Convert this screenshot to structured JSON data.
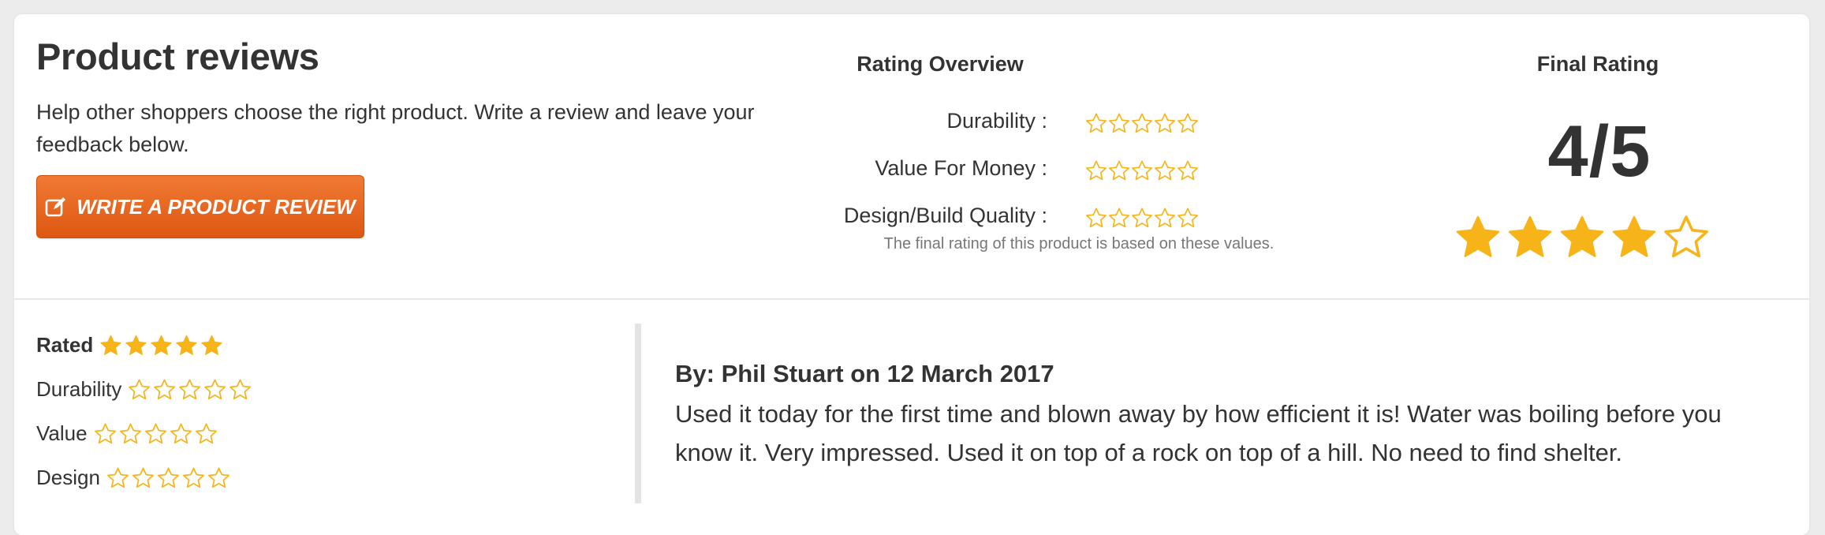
{
  "header": {
    "title": "Product reviews",
    "intro": "Help other shoppers choose the right product. Write a review and leave your feedback below.",
    "write_button_label": "WRITE A PRODUCT REVIEW"
  },
  "overview": {
    "title": "Rating Overview",
    "items": [
      {
        "label": "Durability :",
        "stars_filled": 0,
        "stars_total": 5
      },
      {
        "label": "Value For Money :",
        "stars_filled": 0,
        "stars_total": 5
      },
      {
        "label": "Design/Build Quality :",
        "stars_filled": 0,
        "stars_total": 5
      }
    ],
    "footnote": "The final rating of this product is based on these values."
  },
  "final": {
    "title": "Final Rating",
    "value": "4/5",
    "stars_filled": 4,
    "stars_total": 5
  },
  "review": {
    "ratings": [
      {
        "label": "Rated",
        "stars_filled": 5,
        "stars_total": 5
      },
      {
        "label": "Durability",
        "stars_filled": 0,
        "stars_total": 5
      },
      {
        "label": "Value",
        "stars_filled": 0,
        "stars_total": 5
      },
      {
        "label": "Design",
        "stars_filled": 0,
        "stars_total": 5
      }
    ],
    "author_line": "By: Phil Stuart on 12 March 2017",
    "text": "Used it today for the first time and blown away by how efficient it is! Water was boiling before you know it. Very impressed. Used it on top of a rock on top of a hill. No need to find shelter."
  },
  "colors": {
    "star": "#f6b418",
    "button_top": "#f07a34",
    "button_bottom": "#dd5712"
  },
  "icons": {
    "write_button": "pencil-square-icon",
    "rating": "star-icon"
  }
}
